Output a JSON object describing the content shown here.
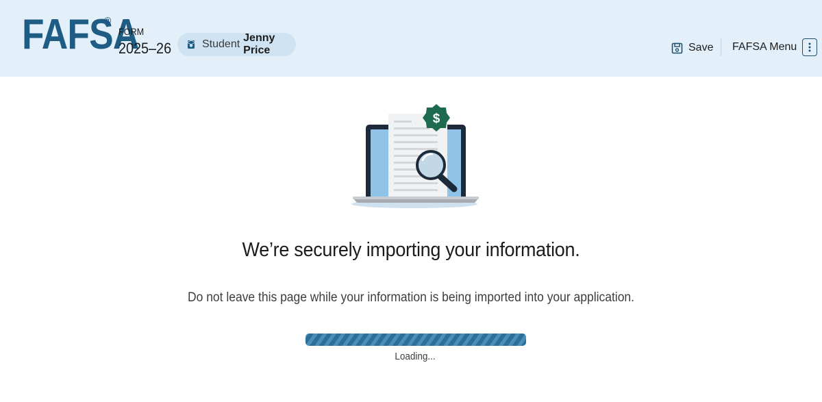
{
  "header": {
    "logo_text": "FAFSA",
    "logo_reg": "®",
    "form_label": "FORM",
    "form_year": "2025–26",
    "student": {
      "role": "Student",
      "name": "Jenny Price",
      "icon": "student-graduate-icon"
    },
    "save_label": "Save",
    "save_icon": "floppy-disk-icon",
    "menu_label": "FAFSA Menu",
    "menu_icon": "kebab-vertical-icon"
  },
  "main": {
    "illustration": "laptop-document-magnifier-dollar-illustration",
    "illustration_badge": "$",
    "title": "We’re securely importing your information.",
    "subtitle": "Do not leave this page while your information is being imported into your application.",
    "loading_label": "Loading..."
  },
  "colors": {
    "header_bg": "#e4f0f9",
    "brand": "#1f5c84",
    "progress_dark": "#2c6f98",
    "progress_light": "#4a8fba",
    "badge_bg": "#cfe3f2",
    "dollar_badge": "#1e6a4e"
  }
}
